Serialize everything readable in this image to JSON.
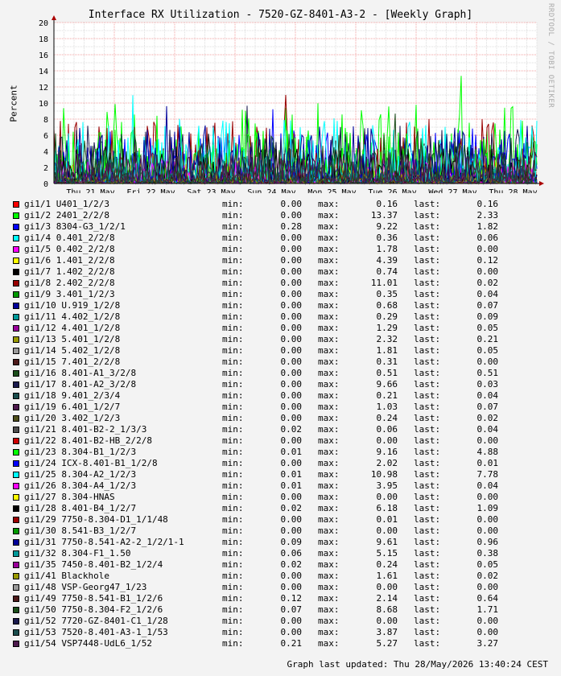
{
  "chart_data": {
    "type": "line",
    "title": "Interface RX Utilization - 7520-GZ-8401-A3-2 - [Weekly Graph]",
    "ylabel": "Percent",
    "xlabel": "",
    "ylim": [
      0,
      20
    ],
    "yticks": [
      "0",
      "2",
      "4",
      "6",
      "8",
      "10",
      "12",
      "14",
      "16",
      "18",
      "20"
    ],
    "xticks": [
      "Thu 21 May",
      "Fri 22 May",
      "Sat 23 May",
      "Sun 24 May",
      "Mon 25 May",
      "Tue 26 May",
      "Wed 27 May",
      "Thu 28 May"
    ],
    "grid": true,
    "legend_placement": "below",
    "series": [
      {
        "name": "gi1/1 U401_1/2/3",
        "color": "#ff0000",
        "min": "0.00",
        "max": "0.16",
        "last": "0.16"
      },
      {
        "name": "gi1/2 2401_2/2/8",
        "color": "#00ff00",
        "min": "0.00",
        "max": "13.37",
        "last": "2.33"
      },
      {
        "name": "gi1/3 8304-G3_1/2/1",
        "color": "#0000ff",
        "min": "0.28",
        "max": "9.22",
        "last": "1.82"
      },
      {
        "name": "gi1/4 0.401_2/2/8",
        "color": "#00ffff",
        "min": "0.00",
        "max": "0.36",
        "last": "0.06"
      },
      {
        "name": "gi1/5 0.402_2/2/8",
        "color": "#ff00ff",
        "min": "0.00",
        "max": "1.78",
        "last": "0.00"
      },
      {
        "name": "gi1/6 1.401_2/2/8",
        "color": "#ffff00",
        "min": "0.00",
        "max": "4.39",
        "last": "0.12"
      },
      {
        "name": "gi1/7 1.402_2/2/8",
        "color": "#000000",
        "min": "0.00",
        "max": "0.74",
        "last": "0.00"
      },
      {
        "name": "gi1/8 2.402_2/2/8",
        "color": "#990000",
        "min": "0.00",
        "max": "11.01",
        "last": "0.02"
      },
      {
        "name": "gi1/9 3.401_1/2/3",
        "color": "#009900",
        "min": "0.00",
        "max": "0.35",
        "last": "0.04"
      },
      {
        "name": "gi1/10 U.919_1/2/8",
        "color": "#000099",
        "min": "0.00",
        "max": "0.68",
        "last": "0.07"
      },
      {
        "name": "gi1/11 4.402_1/2/8",
        "color": "#009999",
        "min": "0.00",
        "max": "0.29",
        "last": "0.09"
      },
      {
        "name": "gi1/12 4.401_1/2/8",
        "color": "#990099",
        "min": "0.00",
        "max": "1.29",
        "last": "0.05"
      },
      {
        "name": "gi1/13 5.401_1/2/8",
        "color": "#999900",
        "min": "0.00",
        "max": "2.32",
        "last": "0.21"
      },
      {
        "name": "gi1/14 5.402_1/2/8",
        "color": "#999999",
        "min": "0.00",
        "max": "1.81",
        "last": "0.05"
      },
      {
        "name": "gi1/15 7.401_2/2/8",
        "color": "#4d1a1a",
        "min": "0.00",
        "max": "0.31",
        "last": "0.00"
      },
      {
        "name": "gi1/16 8.401-A1_3/2/8",
        "color": "#1a4d1a",
        "min": "0.00",
        "max": "0.51",
        "last": "0.51"
      },
      {
        "name": "gi1/17 8.401-A2_3/2/8",
        "color": "#1a1a4d",
        "min": "0.00",
        "max": "9.66",
        "last": "0.03"
      },
      {
        "name": "gi1/18 9.401_2/3/4",
        "color": "#1a4d4d",
        "min": "0.00",
        "max": "0.21",
        "last": "0.04"
      },
      {
        "name": "gi1/19 6.401_1/2/7",
        "color": "#4d1a4d",
        "min": "0.00",
        "max": "1.03",
        "last": "0.07"
      },
      {
        "name": "gi1/20 3.402_1/2/3",
        "color": "#4d4d1a",
        "min": "0.00",
        "max": "0.24",
        "last": "0.02"
      },
      {
        "name": "gi1/21 8.401-B2-2_1/3/3",
        "color": "#4d4d4d",
        "min": "0.02",
        "max": "0.06",
        "last": "0.04"
      },
      {
        "name": "gi1/22 8.401-B2-HB_2/2/8",
        "color": "#cc0000",
        "min": "0.00",
        "max": "0.00",
        "last": "0.00"
      },
      {
        "name": "gi1/23 8.304-B1_1/2/3",
        "color": "#00ff00",
        "min": "0.01",
        "max": "9.16",
        "last": "4.88"
      },
      {
        "name": "gi1/24 ICX-8.401-B1_1/2/8",
        "color": "#0000ff",
        "min": "0.00",
        "max": "2.02",
        "last": "0.01"
      },
      {
        "name": "gi1/25 8.304-A2_1/2/3",
        "color": "#00ffff",
        "min": "0.01",
        "max": "10.98",
        "last": "7.78"
      },
      {
        "name": "gi1/26 8.304-A4_1/2/3",
        "color": "#ff00ff",
        "min": "0.01",
        "max": "3.95",
        "last": "0.04"
      },
      {
        "name": "gi1/27 8.304-HNAS",
        "color": "#ffff00",
        "min": "0.00",
        "max": "0.00",
        "last": "0.00"
      },
      {
        "name": "gi1/28 8.401-B4_1/2/7",
        "color": "#000000",
        "min": "0.02",
        "max": "6.18",
        "last": "1.09"
      },
      {
        "name": "gi1/29 7750-8.304-D1_1/1/48",
        "color": "#990000",
        "min": "0.00",
        "max": "0.01",
        "last": "0.00"
      },
      {
        "name": "gi1/30 8.541-B3_1/2/7",
        "color": "#009900",
        "min": "0.00",
        "max": "0.00",
        "last": "0.00"
      },
      {
        "name": "gi1/31 7750-8.541-A2-2_1/2/1-1",
        "color": "#000099",
        "min": "0.09",
        "max": "9.61",
        "last": "0.96"
      },
      {
        "name": "gi1/32 8.304-F1_1.50",
        "color": "#009999",
        "min": "0.06",
        "max": "5.15",
        "last": "0.38"
      },
      {
        "name": "gi1/35 7450-8.401-B2_1/2/4",
        "color": "#990099",
        "min": "0.02",
        "max": "0.24",
        "last": "0.05"
      },
      {
        "name": "gi1/41 Blackhole",
        "color": "#999900",
        "min": "0.00",
        "max": "1.61",
        "last": "0.02"
      },
      {
        "name": "gi1/48 VSP-Georg47_1/23",
        "color": "#999999",
        "min": "0.00",
        "max": "0.00",
        "last": "0.00"
      },
      {
        "name": "gi1/49 7750-8.541-B1_1/2/6",
        "color": "#4d1a1a",
        "min": "0.12",
        "max": "2.14",
        "last": "0.64"
      },
      {
        "name": "gi1/50 7750-8.304-F2_1/2/6",
        "color": "#1a4d1a",
        "min": "0.07",
        "max": "8.68",
        "last": "1.71"
      },
      {
        "name": "gi1/52 7720-GZ-8401-C1_1/28",
        "color": "#1a1a4d",
        "min": "0.00",
        "max": "0.00",
        "last": "0.00"
      },
      {
        "name": "gi1/53 7520-8.401-A3-1_1/53",
        "color": "#1a4d4d",
        "min": "0.00",
        "max": "3.87",
        "last": "0.00"
      },
      {
        "name": "gi1/54 VSP7448-UdL6_1/52",
        "color": "#4d1a4d",
        "min": "0.21",
        "max": "5.27",
        "last": "3.27"
      }
    ]
  },
  "legend_labels": {
    "min": "min:",
    "max": "max:",
    "last": "last:"
  },
  "watermark": "RRDTOOL / TOBI OETIKER",
  "footer": "Graph last updated: Thu 28/May/2026 13:40:24 CEST"
}
